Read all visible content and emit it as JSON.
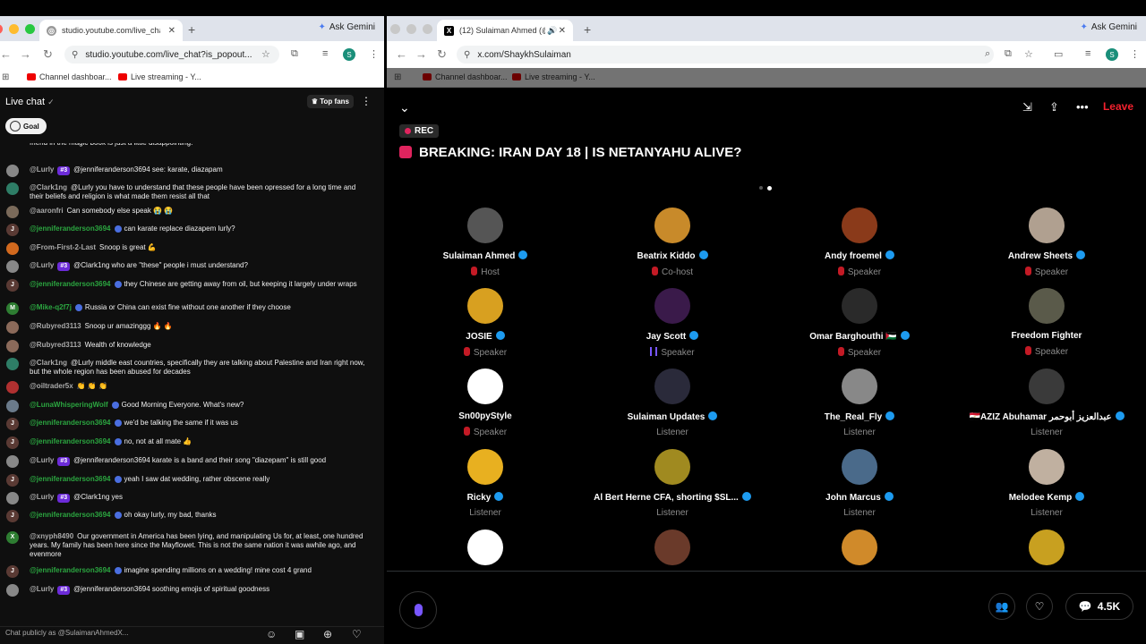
{
  "left_browser": {
    "tab_title": "studio.youtube.com/live_chat",
    "address": "studio.youtube.com/live_chat?is_popout...",
    "ask": "Ask Gemini",
    "profile_letter": "S",
    "bookmarks": [
      "Channel dashboar...",
      "Live streaming - Y..."
    ]
  },
  "right_browser": {
    "tab_title": "(12) Sulaiman Ahmed (@S",
    "address": "x.com/ShaykhSulaiman",
    "ask": "Ask Gemini",
    "bookmarks": [
      "Channel dashboar...",
      "Live streaming - Y..."
    ]
  },
  "chat": {
    "title": "Live chat",
    "top_fans": "Top fans",
    "goal": "Goal",
    "input_placeholder": "Chat publicly as @SulaimanAhmedX...",
    "messages": [
      {
        "author": "",
        "text": "friend in the magic book is just a little disappointing.",
        "color": "#5d8a3a",
        "letter": ""
      },
      {
        "author": "@Lurly",
        "badge": "#3",
        "text": "@jenniferanderson3694 see: karate, diazapam",
        "color": "#888888",
        "letter": ""
      },
      {
        "author": "@Clark1ng",
        "text": "@Lurly you have to understand that these people have been opressed for a long time and their beliefs and religion is what made them resist all that",
        "color": "#2e7d66",
        "letter": ""
      },
      {
        "author": "@aaronfri",
        "text": "Can somebody else speak 😭 😭",
        "color": "#7a6a5a",
        "letter": ""
      },
      {
        "author": "@jenniferanderson3694",
        "verified": true,
        "text": "can karate replace diazapem lurly?",
        "color": "#5a3a34",
        "letter": "J"
      },
      {
        "author": "@From-First-2-Last",
        "text": "Snoop is great 💪",
        "color": "#d2691e",
        "letter": ""
      },
      {
        "author": "@Lurly",
        "badge": "#3",
        "text": "@Clark1ng who are \"these\" people i must understand?",
        "color": "#888888",
        "letter": ""
      },
      {
        "author": "@jenniferanderson3694",
        "verified": true,
        "text": "they Chinese are getting away from oil, but keeping it largely under wraps",
        "color": "#5a3a34",
        "letter": "J"
      },
      {
        "author": "@Mike-q2f7j",
        "verified": true,
        "text": "Russia or China can exist fine without one another if they choose",
        "color": "#2e7d32",
        "letter": "M"
      },
      {
        "author": "@Rubyred3113",
        "text": "Snoop ur amazinggg 🔥 🔥",
        "color": "#8b6a5a",
        "letter": ""
      },
      {
        "author": "@Rubyred3113",
        "text": "Wealth of knowledge",
        "color": "#8b6a5a",
        "letter": ""
      },
      {
        "author": "@Clark1ng",
        "text": "@Lurly middle east countries, specifically they are talking about Palestine and Iran right now, but the whole region has been abused for decades",
        "color": "#2e7d66",
        "letter": ""
      },
      {
        "author": "@oiltrader5x",
        "text": "👏 👏 👏",
        "color": "#b03030",
        "letter": ""
      },
      {
        "author": "@LunaWhisperingWolf",
        "verified": true,
        "text": "Good Morning Everyone. What's new?",
        "color": "#6a7a8a",
        "letter": ""
      },
      {
        "author": "@jenniferanderson3694",
        "verified": true,
        "text": "we'd be talking the same if it was us",
        "color": "#5a3a34",
        "letter": "J"
      },
      {
        "author": "@jenniferanderson3694",
        "verified": true,
        "text": "no, not at all mate 👍",
        "color": "#5a3a34",
        "letter": "J"
      },
      {
        "author": "@Lurly",
        "badge": "#3",
        "text": "@jenniferanderson3694 karate is a band and their song \"diazepam\" is still good",
        "color": "#888888",
        "letter": ""
      },
      {
        "author": "@jenniferanderson3694",
        "verified": true,
        "text": "yeah I saw dat wedding, rather obscene really",
        "color": "#5a3a34",
        "letter": "J"
      },
      {
        "author": "@Lurly",
        "badge": "#3",
        "text": "@Clark1ng yes",
        "color": "#888888",
        "letter": ""
      },
      {
        "author": "@jenniferanderson3694",
        "verified": true,
        "text": "oh okay lurly, my bad, thanks",
        "color": "#5a3a34",
        "letter": "J"
      },
      {
        "author": "@xnyph8490",
        "text": "Our government in America has been lying, and manipulating Us for, at least, one hundred years. My family has been here since the Mayflowet. This is not the same nation it was awhile ago, and evenmore",
        "color": "#2e7d32",
        "letter": "X"
      },
      {
        "author": "@jenniferanderson3694",
        "verified": true,
        "text": "imagine spending millions on a wedding! mine cost 4 grand",
        "color": "#5a3a34",
        "letter": "J"
      },
      {
        "author": "@Lurly",
        "badge": "#3",
        "text": "@jenniferanderson3694 soothing emojis of spiritual goodness",
        "color": "#888888",
        "letter": ""
      }
    ]
  },
  "space": {
    "rec": "REC",
    "title": "BREAKING: IRAN DAY 18 | IS NETANYAHU ALIVE?",
    "leave": "Leave",
    "count": "4.5K",
    "participants": [
      {
        "name": "Sulaiman Ahmed",
        "role": "Host",
        "verified": true,
        "muted": true,
        "avatar": "#555555"
      },
      {
        "name": "Beatrix Kiddo",
        "role": "Co-host",
        "verified": true,
        "muted": true,
        "avatar": "#c88a2a"
      },
      {
        "name": "Andy froemel",
        "role": "Speaker",
        "verified": true,
        "muted": true,
        "avatar": "#8a3a1a"
      },
      {
        "name": "Andrew Sheets",
        "role": "Speaker",
        "verified": true,
        "muted": true,
        "avatar": "#b0a090"
      },
      {
        "name": "JOSIE",
        "role": "Speaker",
        "verified": true,
        "muted": true,
        "avatar": "#d8a020"
      },
      {
        "name": "Jay Scott",
        "role": "Speaker",
        "verified": true,
        "muted": false,
        "avatar": "#3a1a4a"
      },
      {
        "name": "Omar Barghouthi 🇵🇸",
        "role": "Speaker",
        "verified": true,
        "muted": true,
        "avatar": "#2a2a2a"
      },
      {
        "name": "Freedom Fighter",
        "role": "Speaker",
        "verified": false,
        "muted": true,
        "avatar": "#5a5a4a"
      },
      {
        "name": "Sn00pyStyle",
        "role": "Speaker",
        "verified": false,
        "muted": true,
        "avatar": "#ffffff"
      },
      {
        "name": "Sulaiman Updates",
        "role": "Listener",
        "verified": true,
        "muted": false,
        "avatar": "#2a2a3a"
      },
      {
        "name": "The_Real_Fly",
        "role": "Listener",
        "verified": true,
        "muted": false,
        "avatar": "#888888"
      },
      {
        "name": "🇪🇬AZIZ Abuhamar عبدالعزيز أبوحمر",
        "role": "Listener",
        "verified": true,
        "muted": false,
        "avatar": "#3a3a3a"
      },
      {
        "name": "Ricky",
        "role": "Listener",
        "verified": true,
        "muted": false,
        "avatar": "#e8b020"
      },
      {
        "name": "Al Bert Herne CFA, shorting $SL...",
        "role": "Listener",
        "verified": true,
        "muted": false,
        "avatar": "#a08a20"
      },
      {
        "name": "John Marcus",
        "role": "Listener",
        "verified": true,
        "muted": false,
        "avatar": "#4a6a8a"
      },
      {
        "name": "Melodee Kemp",
        "role": "Listener",
        "verified": true,
        "muted": false,
        "avatar": "#c0b0a0"
      },
      {
        "name": "",
        "role": "",
        "verified": false,
        "muted": false,
        "avatar": "#ffffff"
      },
      {
        "name": "",
        "role": "",
        "verified": false,
        "muted": false,
        "avatar": "#6a3a2a"
      },
      {
        "name": "",
        "role": "",
        "verified": false,
        "muted": false,
        "avatar": "#d08a2a"
      },
      {
        "name": "",
        "role": "",
        "verified": false,
        "muted": false,
        "avatar": "#c8a020"
      }
    ]
  }
}
